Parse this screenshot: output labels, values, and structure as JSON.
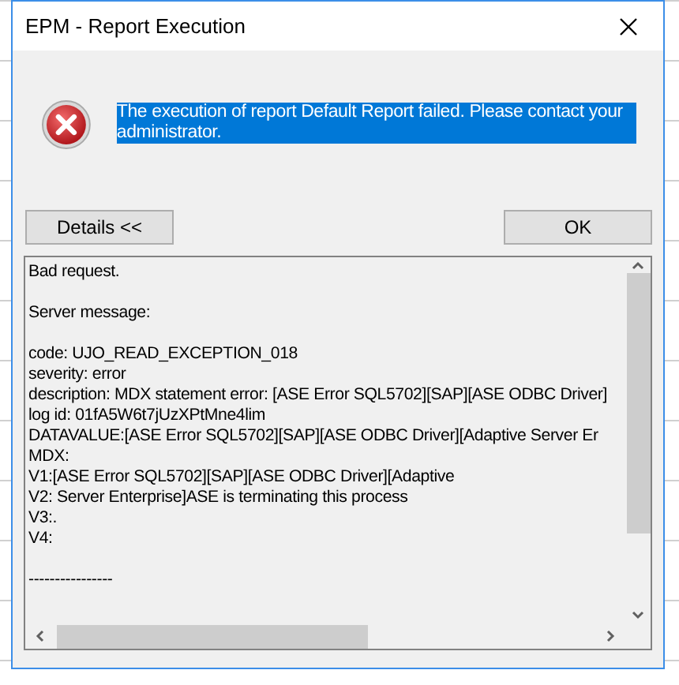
{
  "window": {
    "title": "EPM - Report Execution"
  },
  "message": {
    "text": "The execution of report Default Report failed. Please contact your administrator.",
    "selected": true
  },
  "details_button": {
    "label": "Details <<"
  },
  "ok_button": {
    "label": "OK"
  },
  "details": {
    "paragraphs": [
      [
        "Bad request."
      ],
      [
        "Server message:"
      ],
      [
        "code: UJO_READ_EXCEPTION_018",
        "severity: error",
        "description: MDX statement error: [ASE Error SQL5702][SAP][ASE ODBC Driver]",
        "log id: 01fA5W6t7jUzXPtMne4lim",
        "DATAVALUE:[ASE Error SQL5702][SAP][ASE ODBC Driver][Adaptive Server Er",
        "MDX:",
        "V1:[ASE Error SQL5702][SAP][ASE ODBC Driver][Adaptive",
        "V2: Server Enterprise]ASE is terminating this process",
        "V3:.",
        "V4:"
      ],
      [
        "----------------"
      ]
    ]
  }
}
